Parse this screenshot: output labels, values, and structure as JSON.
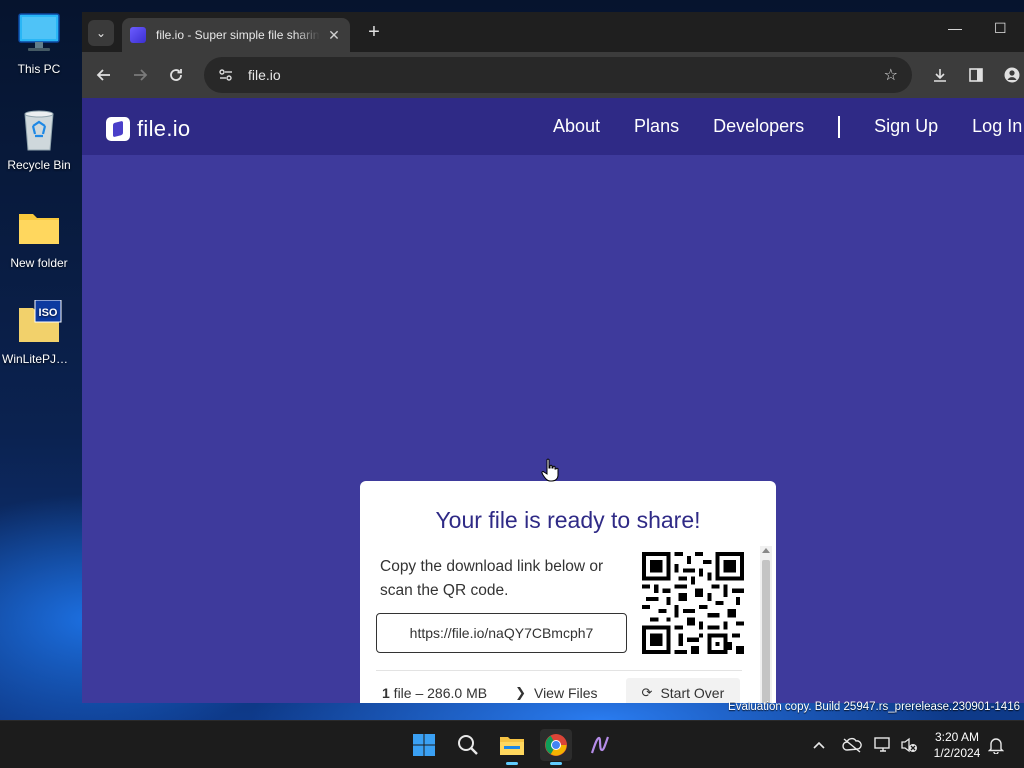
{
  "desktop": {
    "icons": [
      {
        "label": "This PC"
      },
      {
        "label": "Recycle Bin"
      },
      {
        "label": "New folder"
      },
      {
        "label": "WinLitePJSK..."
      }
    ],
    "iso_badge": "ISO"
  },
  "browser": {
    "tab": {
      "title": "file.io - Super simple file sharing",
      "close": "✕"
    },
    "new_tab": "+",
    "window_controls": {
      "minimize": "—",
      "maximize": "☐"
    },
    "url": "file.io"
  },
  "site": {
    "logo_text": "file.io",
    "nav": [
      "About",
      "Plans",
      "Developers",
      "Sign Up",
      "Log In"
    ]
  },
  "share_card": {
    "title": "Your file is ready to share!",
    "description": "Copy the download link below or scan the QR code.",
    "link": "https://file.io/naQY7CBmcph7",
    "file_count": "1",
    "file_info_rest": " file – 286.0 MB",
    "view_files": "View Files",
    "start_over": "Start Over"
  },
  "watermark": "Evaluation copy. Build 25947.rs_prerelease.230901-1416",
  "taskbar": {
    "time": "3:20 AM",
    "date": "1/2/2024"
  },
  "colors": {
    "page_bg": "#3e3a9c",
    "header_bg": "#2f2a86",
    "title_color": "#2f2a86"
  }
}
